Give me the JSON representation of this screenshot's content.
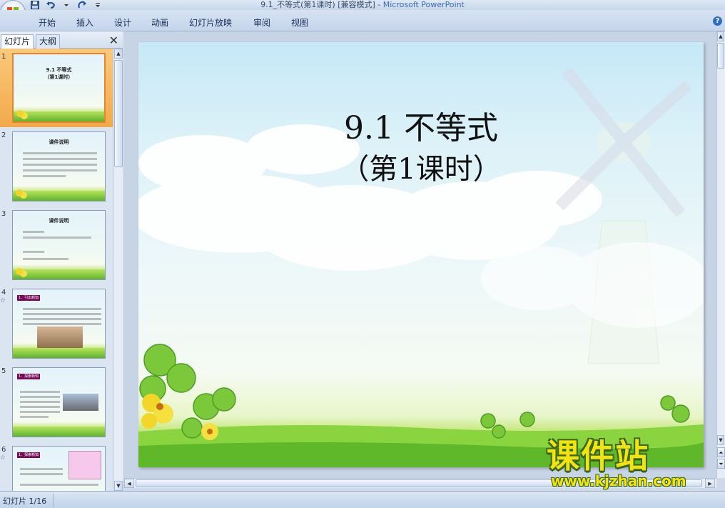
{
  "window": {
    "title": "9.1_不等式(第1课时) [兼容模式] - ",
    "app_name": "Microsoft PowerPoint"
  },
  "ribbon": {
    "tabs": [
      "开始",
      "插入",
      "设计",
      "动画",
      "幻灯片放映",
      "审阅",
      "视图"
    ]
  },
  "left_pane": {
    "tabs": [
      "幻灯片",
      "大纲"
    ],
    "close_glyph": "✕",
    "slides": [
      {
        "number": "1",
        "title_lines": [
          "9.1 不等式",
          "（第1课时）"
        ],
        "selected": true,
        "has_animation": false
      },
      {
        "number": "2",
        "title_lines": [
          "课件说明"
        ],
        "selected": false,
        "has_animation": false
      },
      {
        "number": "3",
        "title_lines": [
          "课件说明"
        ],
        "selected": false,
        "has_animation": false
      },
      {
        "number": "4",
        "title_lines": [
          "1．引出新知"
        ],
        "selected": false,
        "has_animation": true
      },
      {
        "number": "5",
        "title_lines": [
          "1．探索新知"
        ],
        "selected": false,
        "has_animation": false
      },
      {
        "number": "6",
        "title_lines": [
          "1．探索新知"
        ],
        "selected": false,
        "has_animation": true
      }
    ],
    "animation_glyph": "☆"
  },
  "slide": {
    "title": "9.1  不等式",
    "subtitle": "（第1课时）"
  },
  "status_bar": {
    "text": "幻灯片 1/16"
  },
  "watermark": {
    "brand": "课件站",
    "url": "www.kjzhan.com"
  },
  "colors": {
    "selected_thumb": "#f3a94b",
    "ribbon": "#c5d5ea",
    "grass": "#6fc533"
  }
}
